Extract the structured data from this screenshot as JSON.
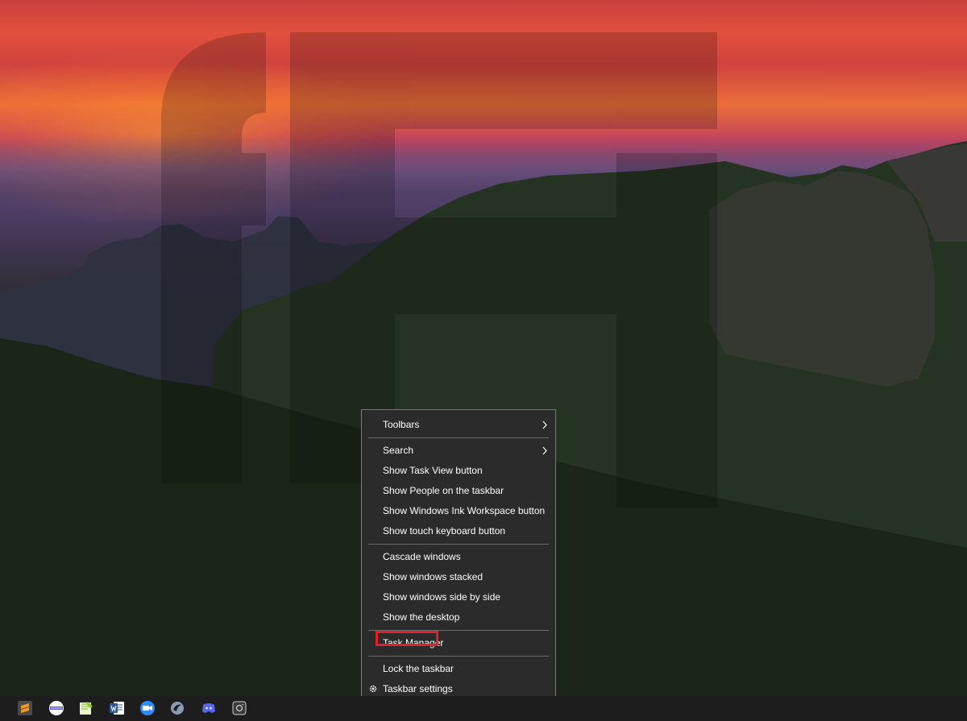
{
  "context_menu": {
    "items": [
      {
        "label": "Toolbars",
        "has_submenu": true
      },
      {
        "label": "Search",
        "has_submenu": true
      },
      {
        "label": "Show Task View button"
      },
      {
        "label": "Show People on the taskbar"
      },
      {
        "label": "Show Windows Ink Workspace button"
      },
      {
        "label": "Show touch keyboard button"
      },
      {
        "label": "Cascade windows"
      },
      {
        "label": "Show windows stacked"
      },
      {
        "label": "Show windows side by side"
      },
      {
        "label": "Show the desktop"
      },
      {
        "label": "Task Manager",
        "highlighted": true
      },
      {
        "label": "Lock the taskbar"
      },
      {
        "label": "Taskbar settings",
        "icon": "gear-icon"
      }
    ],
    "highlight_color": "#e0202a"
  },
  "taskbar": {
    "icons": [
      {
        "name": "sublime-text-icon",
        "color": "#f29a1a"
      },
      {
        "name": "terminal-app-icon",
        "color": "#5a5adf"
      },
      {
        "name": "notepad-plus-icon",
        "color": "#8dc63f"
      },
      {
        "name": "word-icon",
        "color": "#2b579a"
      },
      {
        "name": "zoom-icon",
        "color": "#2d8cff"
      },
      {
        "name": "steam-like-icon",
        "color": "#8a9bb5"
      },
      {
        "name": "discord-icon",
        "color": "#5865f2"
      },
      {
        "name": "camera-app-icon",
        "color": "#cfcfcf"
      }
    ]
  },
  "colors": {
    "menu_bg": "#2b2b2b",
    "menu_text": "#ffffff",
    "taskbar_bg": "#1e1d1d"
  }
}
